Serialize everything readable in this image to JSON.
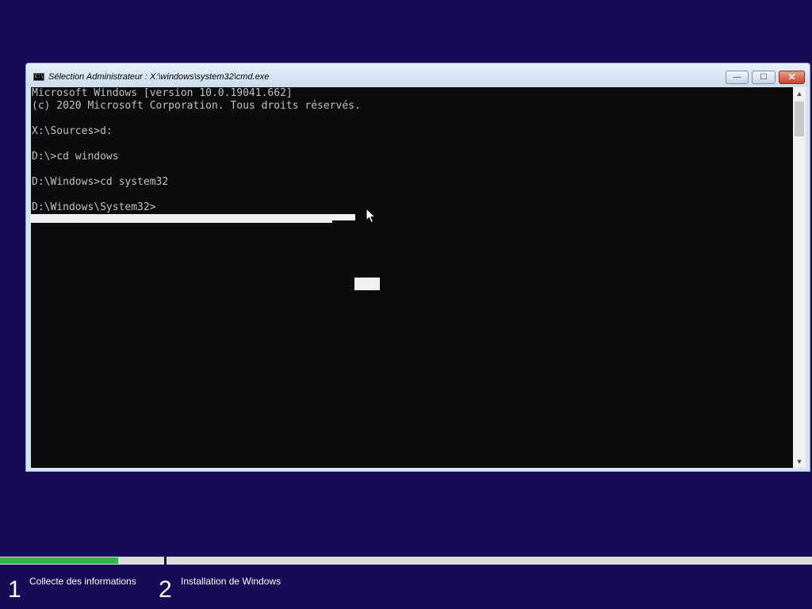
{
  "window": {
    "title": "Sélection Administrateur : X:\\windows\\system32\\cmd.exe",
    "icon": "cmd-console-icon",
    "icon_text": "C:\\",
    "buttons": {
      "minimize": "—",
      "maximize": "☐",
      "close": "✕"
    }
  },
  "console": {
    "lines": [
      "Microsoft Windows [version 10.0.19041.662]",
      "(c) 2020 Microsoft Corporation. Tous droits réservés.",
      "",
      "X:\\Sources>d:",
      "",
      "D:\\>cd windows",
      "",
      "D:\\Windows>cd system32",
      "",
      "D:\\Windows\\System32>"
    ],
    "colors": {
      "background": "#0c0c0c",
      "text": "#c0c0c0",
      "selection": "#f0f0f0"
    }
  },
  "scrollbar": {
    "up_arrow": "▲",
    "down_arrow": "▼"
  },
  "setup_progress": {
    "completed_fraction_step1": 0.72,
    "fill_color": "#2fb447",
    "steps": [
      {
        "number": "1",
        "label": "Collecte des informations"
      },
      {
        "number": "2",
        "label": "Installation de Windows"
      }
    ]
  },
  "background_color": "#170b55"
}
